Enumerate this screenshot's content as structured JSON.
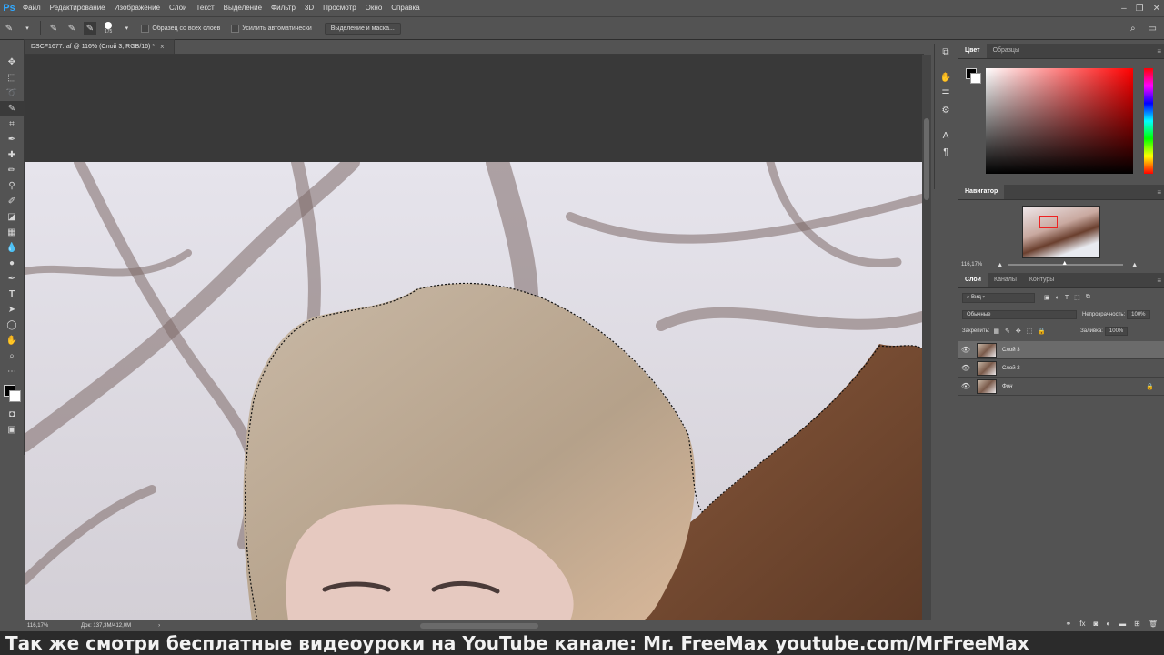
{
  "app": {
    "logo": "Ps"
  },
  "menu": [
    "Файл",
    "Редактирование",
    "Изображение",
    "Слои",
    "Текст",
    "Выделение",
    "Фильтр",
    "3D",
    "Просмотр",
    "Окно",
    "Справка"
  ],
  "options": {
    "brush_size": "175",
    "sample_all_layers": "Образец со всех слоев",
    "auto_enhance": "Усилить автоматически",
    "select_and_mask": "Выделение и маска..."
  },
  "document": {
    "tab_title": "DSCF1677.raf @ 116% (Слой 3, RGB/16) *",
    "close": "×"
  },
  "status": {
    "zoom": "116,17%",
    "doc_size": "Док: 137,3M/412,0M"
  },
  "panels": {
    "color_tabs": [
      "Цвет",
      "Образцы"
    ],
    "navigator_title": "Навигатор",
    "navigator_zoom": "116,17%",
    "layers_tabs": [
      "Слои",
      "Каналы",
      "Контуры"
    ],
    "kind_filter": "Вид",
    "blend_mode": "Обычные",
    "opacity_label": "Непрозрачность:",
    "opacity_value": "100%",
    "lock_label": "Закрепить:",
    "fill_label": "Заливка:",
    "fill_value": "100%",
    "layers": [
      {
        "name": "Слой 3",
        "selected": true
      },
      {
        "name": "Слой 2",
        "selected": false
      },
      {
        "name": "Фон",
        "selected": false,
        "locked": true
      }
    ]
  },
  "caption": {
    "text": "Так же смотри бесплатные видеоуроки на YouTube канале: Mr. FreeMax",
    "url": "youtube.com/MrFreeMax"
  },
  "colors": {
    "accent": "#31a8ff",
    "ui_bg": "#535353"
  }
}
